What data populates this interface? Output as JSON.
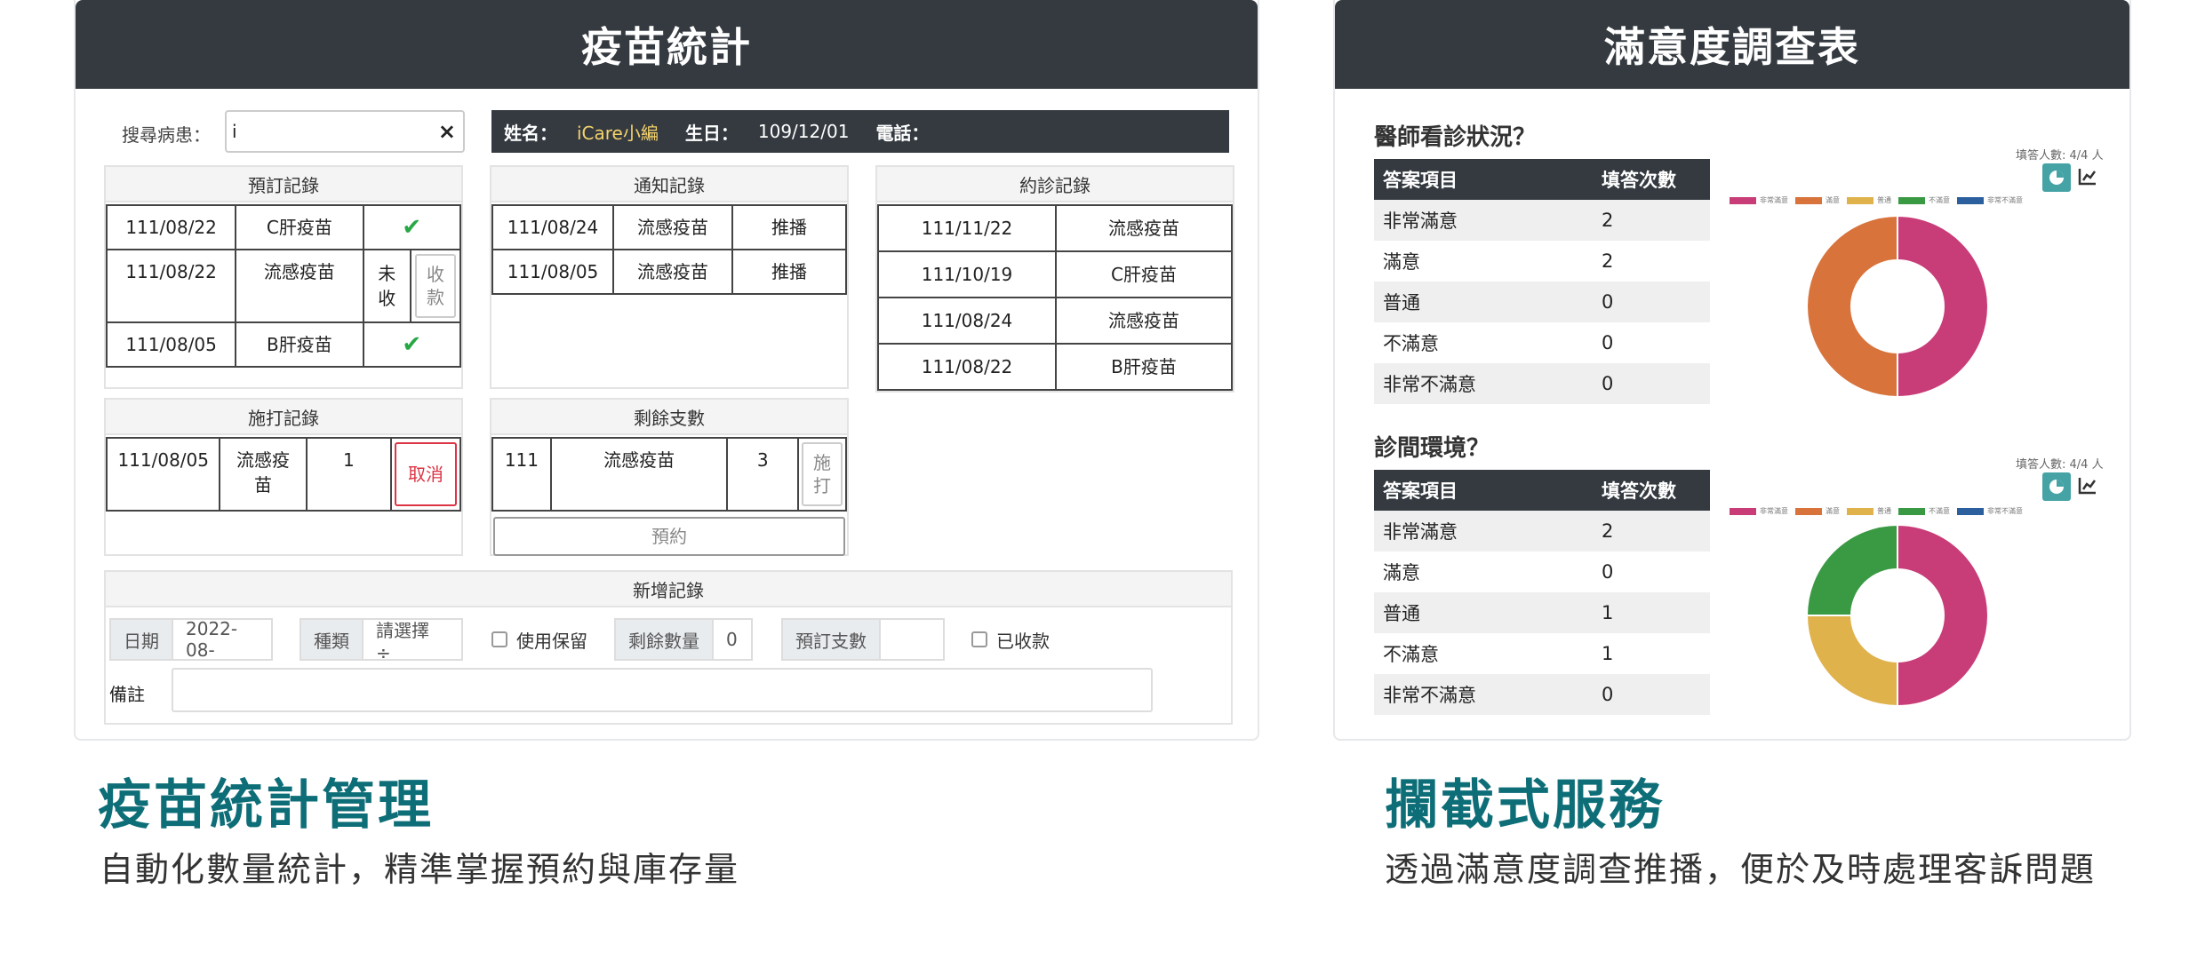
{
  "left_panel": {
    "title": "疫苗統計",
    "search": {
      "label": "搜尋病患：",
      "value": "i",
      "clear": "×"
    },
    "patient": {
      "name_label": "姓名：",
      "name": "iCare小編",
      "birth_label": "生日：",
      "birth": "109/12/01",
      "phone_label": "電話："
    },
    "reservation": {
      "title": "預訂記錄",
      "rows": [
        {
          "date": "111/08/22",
          "vaccine": "C肝疫苗",
          "status": "✔"
        },
        {
          "date": "111/08/22",
          "vaccine": "流感疫苗",
          "status": "未收",
          "action": "收款"
        },
        {
          "date": "111/08/05",
          "vaccine": "B肝疫苗",
          "status": "✔"
        }
      ]
    },
    "notification": {
      "title": "通知記錄",
      "rows": [
        {
          "date": "111/08/24",
          "vaccine": "流感疫苗",
          "type": "推播"
        },
        {
          "date": "111/08/05",
          "vaccine": "流感疫苗",
          "type": "推播"
        }
      ]
    },
    "appointment": {
      "title": "約診記錄",
      "rows": [
        {
          "date": "111/11/22",
          "vaccine": "流感疫苗"
        },
        {
          "date": "111/10/19",
          "vaccine": "C肝疫苗"
        },
        {
          "date": "111/08/24",
          "vaccine": "流感疫苗"
        },
        {
          "date": "111/08/22",
          "vaccine": "B肝疫苗"
        }
      ]
    },
    "injection": {
      "title": "施打記錄",
      "rows": [
        {
          "date": "111/08/05",
          "vaccine": "流感疫苗",
          "count": "1",
          "action": "取消"
        }
      ]
    },
    "remaining": {
      "title": "剩餘支數",
      "rows": [
        {
          "year": "111",
          "vaccine": "流感疫苗",
          "count": "3",
          "action": "施打"
        }
      ],
      "book": "預約"
    },
    "new_record": {
      "title": "新增記錄",
      "date_label": "日期",
      "date_value": "2022-08-",
      "type_label": "種類",
      "type_value": "請選擇 ÷",
      "reserve_label": "使用保留",
      "remain_label": "剩餘數量",
      "remain_value": "0",
      "preorder_label": "預訂支數",
      "paid_label": "已收款",
      "note_label": "備註"
    }
  },
  "right_panel": {
    "title": "滿意度調查表",
    "surveys": [
      {
        "question": "醫師看診狀況？",
        "col1": "答案項目",
        "col2": "填答次數",
        "rows": [
          {
            "answer": "非常滿意",
            "count": "2"
          },
          {
            "answer": "滿意",
            "count": "2"
          },
          {
            "answer": "普通",
            "count": "0"
          },
          {
            "answer": "不滿意",
            "count": "0"
          },
          {
            "answer": "非常不滿意",
            "count": "0"
          }
        ],
        "respondents": "填答人數: 4/4 人"
      },
      {
        "question": "診間環境？",
        "col1": "答案項目",
        "col2": "填答次數",
        "rows": [
          {
            "answer": "非常滿意",
            "count": "2"
          },
          {
            "answer": "滿意",
            "count": "0"
          },
          {
            "answer": "普通",
            "count": "1"
          },
          {
            "answer": "不滿意",
            "count": "1"
          },
          {
            "answer": "非常不滿意",
            "count": "0"
          }
        ],
        "respondents": "填答人數: 4/4 人"
      }
    ],
    "legend": [
      "非常滿意",
      "滿意",
      "普通",
      "不滿意",
      "非常不滿意"
    ],
    "colors": [
      "#c83c78",
      "#d8733c",
      "#e0b24c",
      "#3a9a44",
      "#2c5f9e"
    ]
  },
  "captions": {
    "left_heading": "疫苗統計管理",
    "left_sub": "自動化數量統計，精準掌握預約與庫存量",
    "right_heading": "攔截式服務",
    "right_sub": "透過滿意度調查推播，便於及時處理客訴問題"
  }
}
